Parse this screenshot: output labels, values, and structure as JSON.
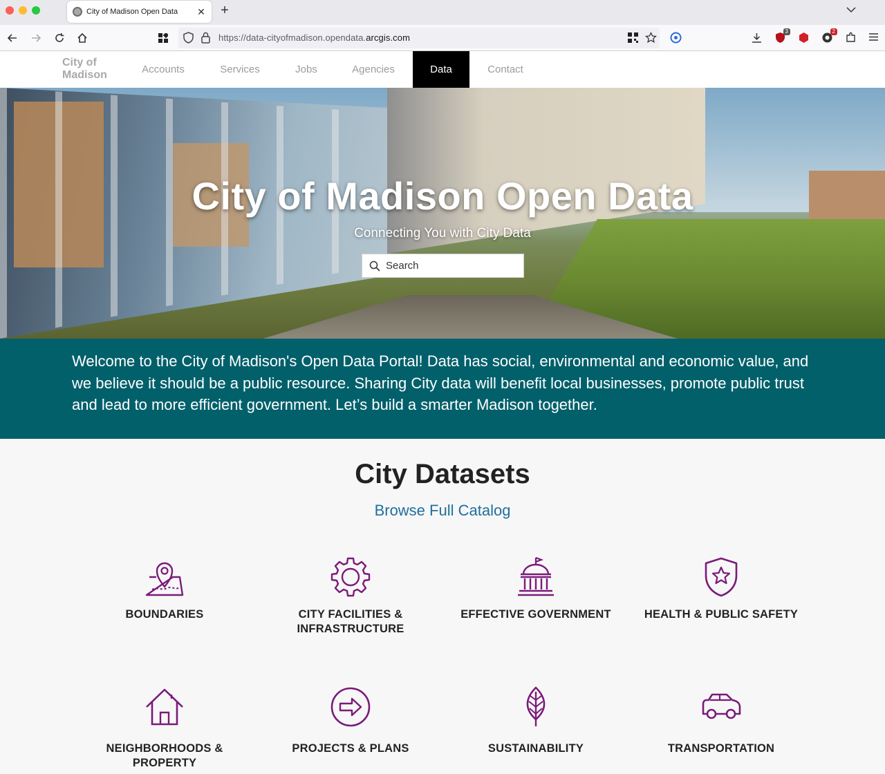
{
  "browser": {
    "tab_title": "City of Madison Open Data",
    "url_prefix": "https://data-cityofmadison.opendata.",
    "url_host": "arcgis.com",
    "extension_badges": {
      "ublock": "3",
      "notifications": "2"
    }
  },
  "site": {
    "logo": "City of Madison",
    "nav": [
      "Accounts",
      "Services",
      "Jobs",
      "Agencies",
      "Data",
      "Contact"
    ],
    "active_nav": "Data"
  },
  "hero": {
    "title": "City of Madison Open Data",
    "subtitle": "Connecting You with City Data",
    "search_placeholder": "Search"
  },
  "welcome": {
    "text": "Welcome to the City of Madison's Open Data Portal! Data has social, environmental and economic value, and we believe it should be a public resource. Sharing City data will benefit local businesses, promote public trust and lead to more efficient government. Let’s build a smarter Madison together."
  },
  "datasets": {
    "title": "City Datasets",
    "catalog_link": "Browse Full Catalog",
    "icon_color": "#7a1a7a",
    "categories": [
      {
        "label": "BOUNDARIES",
        "icon": "map-pin-icon"
      },
      {
        "label": "CITY FACILITIES & INFRASTRUCTURE",
        "icon": "gear-icon"
      },
      {
        "label": "EFFECTIVE GOVERNMENT",
        "icon": "capitol-building-icon"
      },
      {
        "label": "HEALTH & PUBLIC SAFETY",
        "icon": "shield-star-icon"
      },
      {
        "label": "NEIGHBORHOODS & PROPERTY",
        "icon": "house-icon"
      },
      {
        "label": "PROJECTS & PLANS",
        "icon": "arrow-circle-icon"
      },
      {
        "label": "SUSTAINABILITY",
        "icon": "leaf-icon"
      },
      {
        "label": "TRANSPORTATION",
        "icon": "car-icon"
      }
    ]
  },
  "colors": {
    "welcome_bg": "#02606b",
    "nav_active_bg": "#000000",
    "link": "#1f6f9c"
  }
}
